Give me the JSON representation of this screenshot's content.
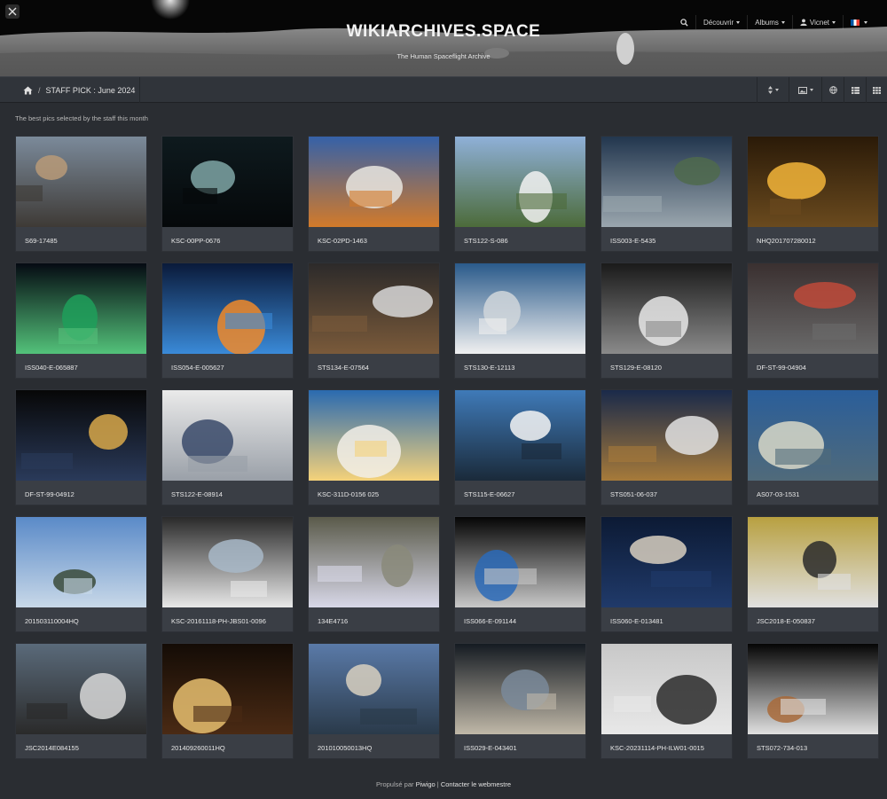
{
  "header": {
    "title": "WIKIARCHIVES.SPACE",
    "subtitle": "The Human Spaceflight Archive",
    "menu": {
      "discover": "Découvrir",
      "albums": "Albums",
      "user": "Vicnet"
    }
  },
  "breadcrumb": {
    "current": "STAFF PICK : June 2024"
  },
  "description": "The best pics selected by the staff this month",
  "photos": [
    "S69-17485",
    "KSC-00PP-0676",
    "KSC-02PD-1463",
    "STS122-S-086",
    "ISS003-E-5435",
    "NHQ201707280012",
    "ISS040-E-065887",
    "ISS054-E-005627",
    "STS134-E-07564",
    "STS130-E-12113",
    "STS129-E-08120",
    "DF-ST-99-04904",
    "DF-ST-99-04912",
    "STS122-E-08914",
    "KSC-311D-0156 025",
    "STS115-E-06627",
    "STS051-06-037",
    "AS07-03-1531",
    "201503110004HQ",
    "KSC-20161118-PH-JBS01-0096",
    "134E4716",
    "ISS066-E-091144",
    "ISS060-E-013481",
    "JSC2018-E-050837",
    "JSC2014E084155",
    "201409260011HQ",
    "201010050013HQ",
    "ISS029-E-043401",
    "KSC-20231114-PH-ILW01-0015",
    "STS072-734-013"
  ],
  "footer": {
    "prefix": "Propulsé par",
    "engine": "Piwigo",
    "separator": "|",
    "contact": "Contacter le webmestre"
  },
  "colors": {
    "background": "#2a2d32",
    "card": "#3a3e45",
    "navbar": "#30343a"
  }
}
